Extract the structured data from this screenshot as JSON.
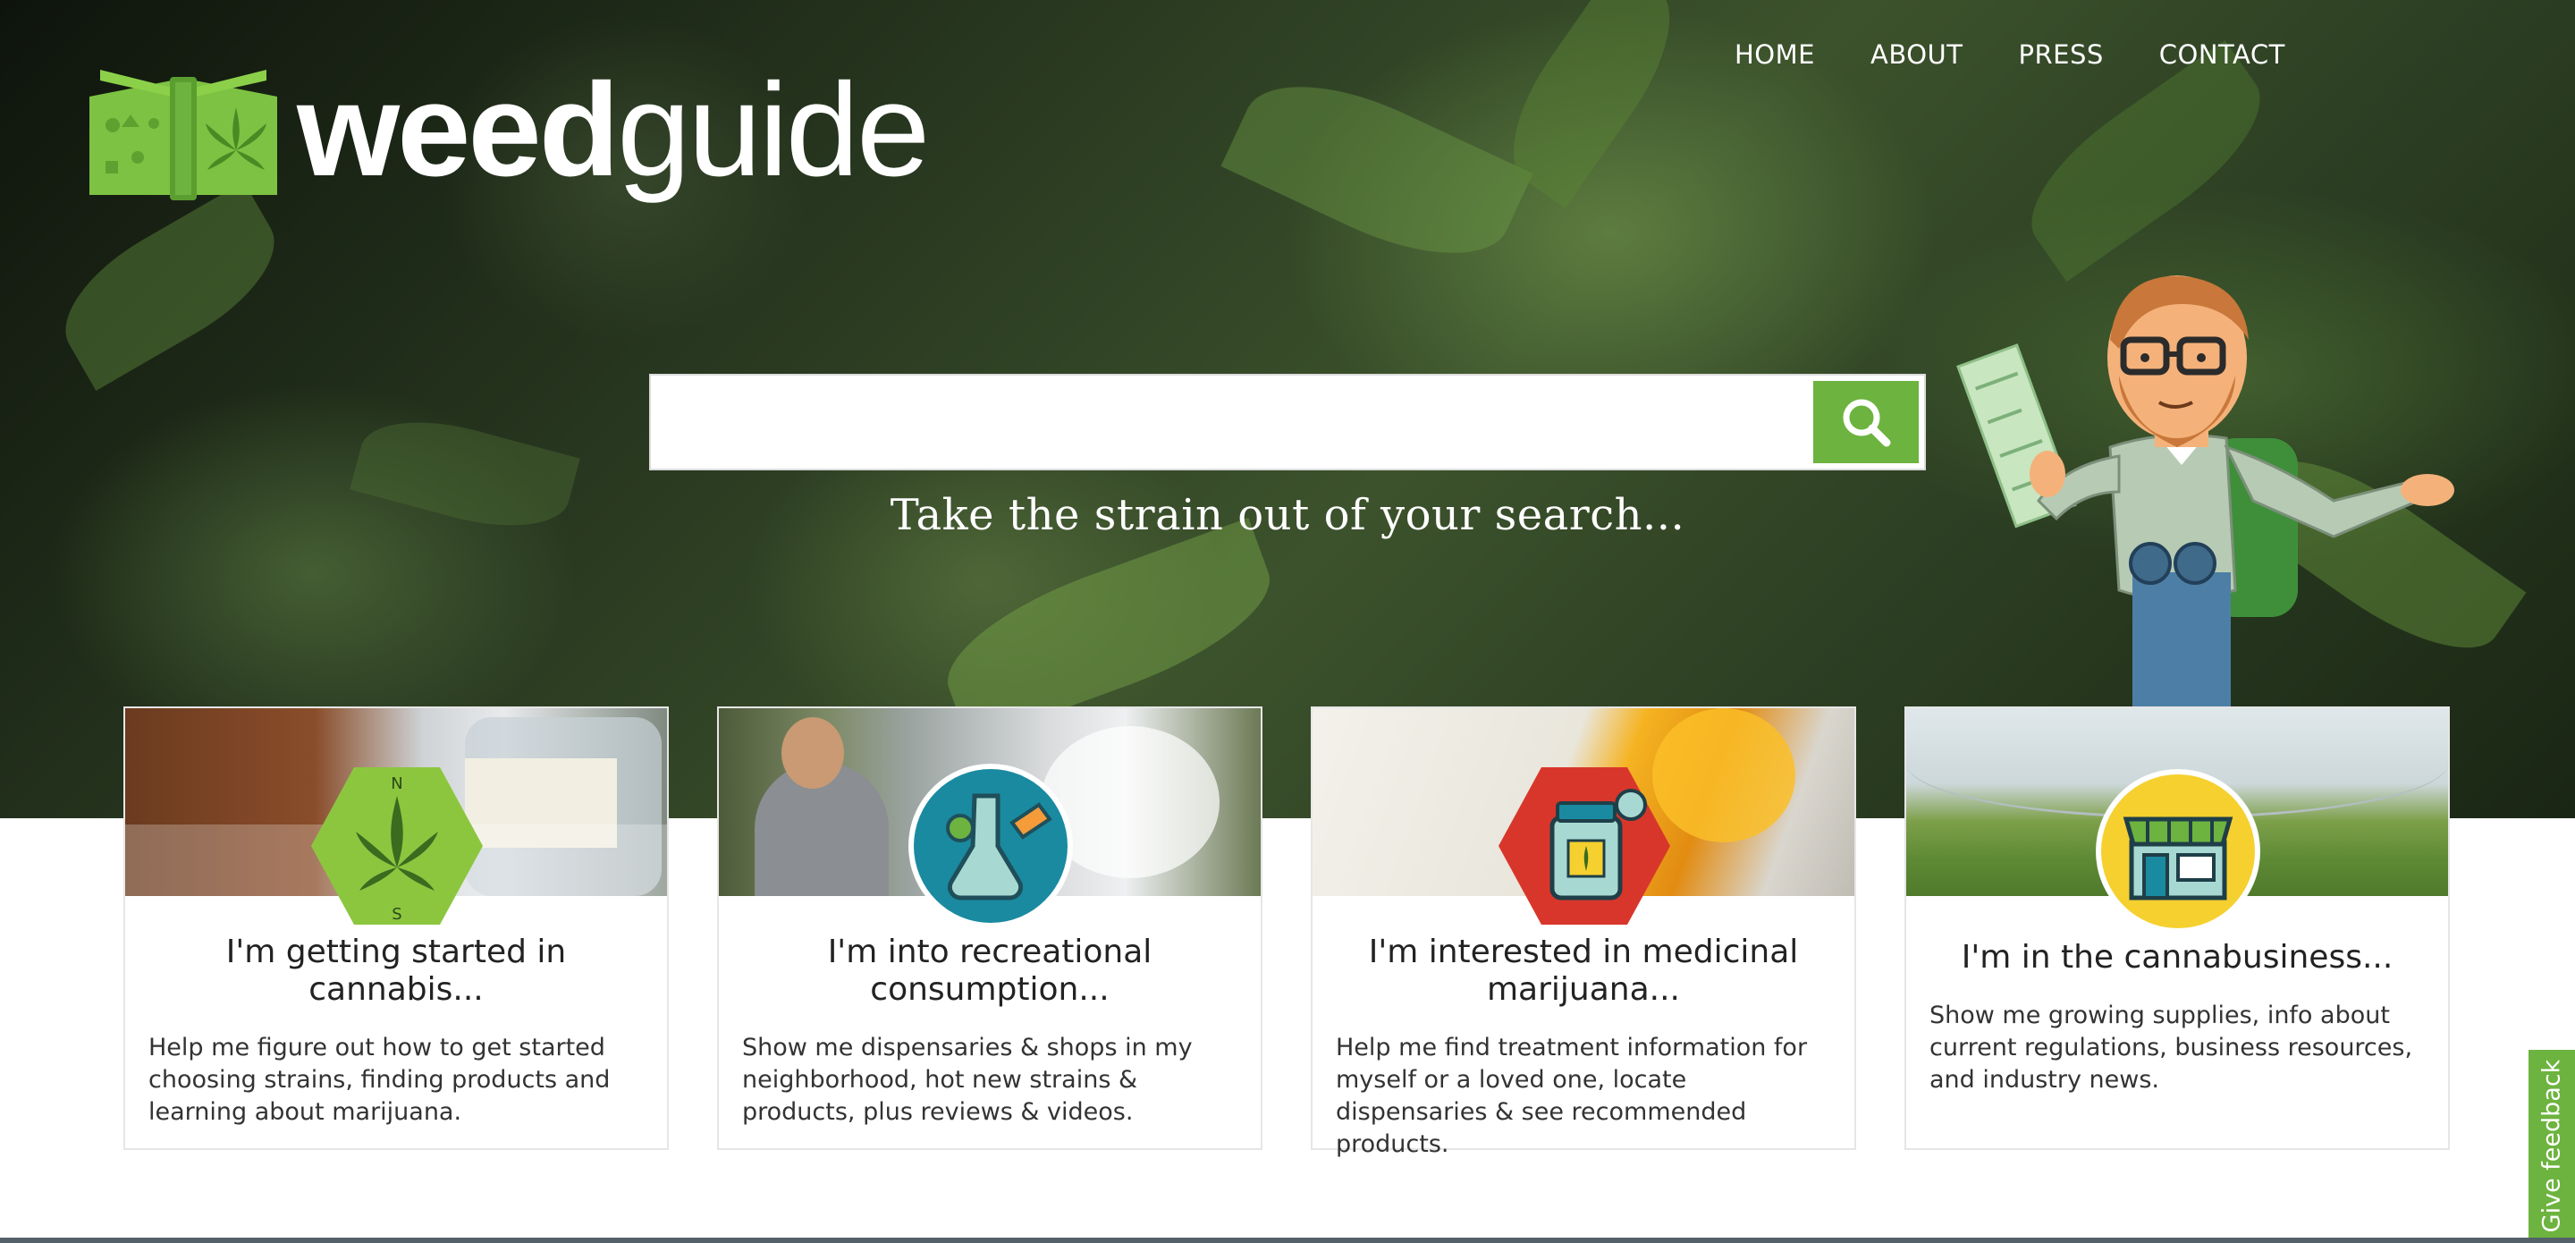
{
  "brand": {
    "logo_bold": "weed",
    "logo_light": "guide"
  },
  "nav": {
    "items": [
      "HOME",
      "ABOUT",
      "PRESS",
      "CONTACT"
    ]
  },
  "search": {
    "placeholder": "",
    "value": "",
    "button_icon": "search-icon"
  },
  "tagline": "Take the strain out of your search...",
  "cards": [
    {
      "title": "I'm getting started in cannabis...",
      "description": "Help me figure out how to get started choosing strains, finding products and learning about marijuana.",
      "icon": "compass-leaf-icon",
      "badge_color": "#8cc63f"
    },
    {
      "title": "I'm into recreational consumption...",
      "description": "Show me dispensaries & shops in my neighborhood, hot new strains & products, plus reviews & videos.",
      "icon": "bong-icon",
      "badge_color": "#1a8aa0"
    },
    {
      "title": "I'm interested in medicinal marijuana...",
      "description": "Help me find treatment information for myself or a loved one, locate dispensaries & see recommended products.",
      "icon": "medicine-jar-icon",
      "badge_color": "#d9362b"
    },
    {
      "title": "I'm in the cannabusiness...",
      "description": "Show me growing supplies, info about current regulations, business resources, and industry news.",
      "icon": "storefront-icon",
      "badge_color": "#f5d02f"
    }
  ],
  "feedback": {
    "label": "Give feedback"
  },
  "colors": {
    "accent": "#6db33f",
    "text_dark": "#222222"
  }
}
